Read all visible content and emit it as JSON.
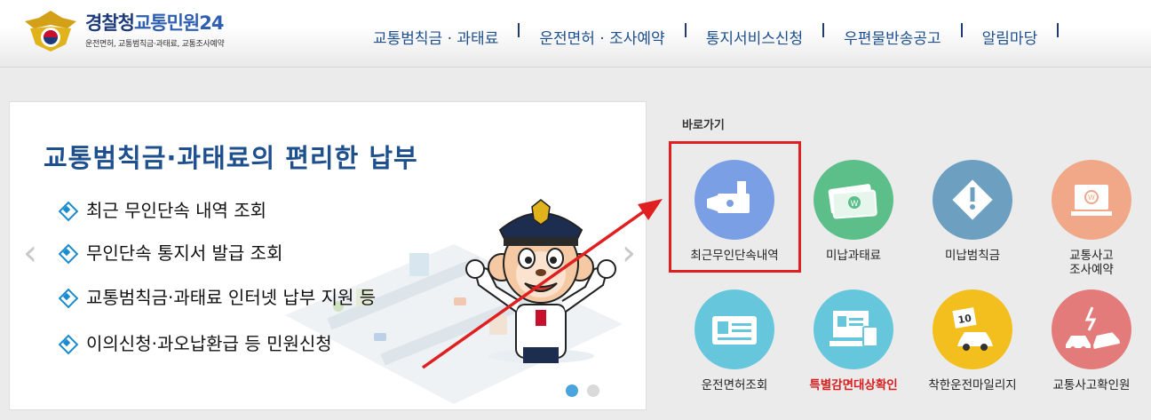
{
  "header": {
    "logo_title_part1": "경찰청",
    "logo_title_part2": "교통민원24",
    "logo_subtitle": "운전면허, 교통범칙금·과태료, 교통조사예약"
  },
  "nav": {
    "items": [
      "교통범칙금 · 과태료",
      "운전면허 · 조사예약",
      "통지서비스신청",
      "우편물반송공고",
      "알림마당"
    ]
  },
  "banner": {
    "title": "교통범칙금·과태료의 편리한 납부",
    "bullets": [
      "최근 무인단속 내역 조회",
      "무인단속 통지서 발급 조회",
      "교통범칙금·과태료 인터넷 납부 지원 등",
      "이의신청·과오납환급 등 민원신청"
    ],
    "prev_symbol": "‹",
    "next_symbol": "›",
    "slides_total": 2,
    "slide_active": 1
  },
  "quick": {
    "label": "바로가기",
    "tiles": [
      {
        "label": "최근무인단속내역",
        "icon": "camera-icon",
        "color": "#7b9fe4",
        "highlighted": true
      },
      {
        "label": "미납과태료",
        "icon": "money-icon",
        "color": "#5cbf8a"
      },
      {
        "label": "미납범칙금",
        "icon": "warning-icon",
        "color": "#6d9fc1"
      },
      {
        "label": "교통사고\n조사예약",
        "icon": "computer-icon",
        "color": "#f0a888"
      },
      {
        "label": "운전면허조회",
        "icon": "license-card-icon",
        "color": "#66c7dc"
      },
      {
        "label": "특별감면대상확인",
        "icon": "monitor-id-icon",
        "color": "#66c7dc",
        "label_color": "#d81e1e"
      },
      {
        "label": "착한운전마일리지",
        "icon": "mileage-car-icon",
        "color": "#f3bf1e"
      },
      {
        "label": "교통사고확인원",
        "icon": "crash-icon",
        "color": "#e37b7b"
      }
    ]
  },
  "colors": {
    "brand_blue": "#1e4f8f",
    "accent_red": "#e02020",
    "dot_active": "#49a3dc",
    "dot_inactive": "#d9d9d9"
  }
}
